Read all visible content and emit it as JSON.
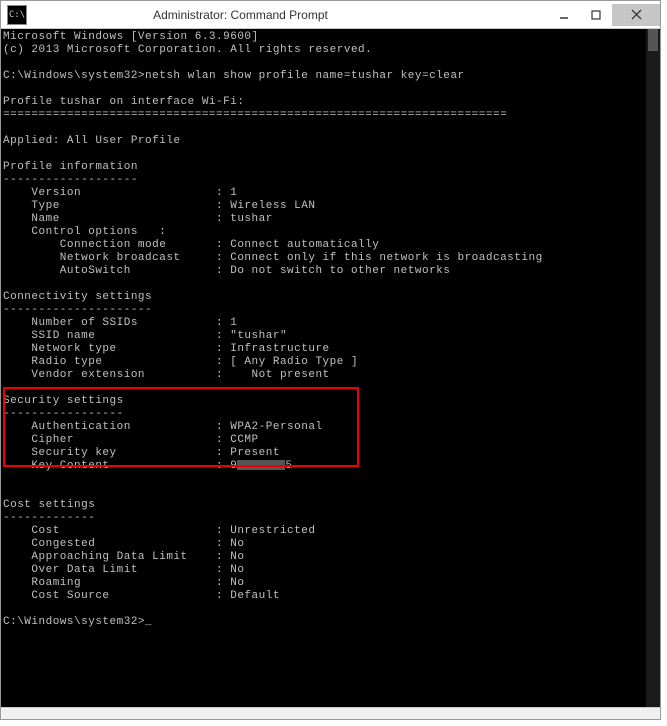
{
  "titlebar": {
    "icon_label": "C:\\",
    "title": "Administrator: Command Prompt"
  },
  "header": {
    "version_line": "Microsoft Windows [Version 6.3.9600]",
    "copyright_line": "(c) 2013 Microsoft Corporation. All rights reserved."
  },
  "prompt1": {
    "path": "C:\\Windows\\system32>",
    "command": "netsh wlan show profile name=tushar key=clear"
  },
  "profile_header": "Profile tushar on interface Wi-Fi:",
  "separator": "=======================================================================",
  "applied": {
    "label": "Applied:",
    "value": "All User Profile"
  },
  "sections": {
    "profile_info": {
      "title": "Profile information",
      "underline": "-------------------",
      "rows": [
        {
          "k": "Version",
          "v": "1"
        },
        {
          "k": "Type",
          "v": "Wireless LAN"
        },
        {
          "k": "Name",
          "v": "tushar"
        },
        {
          "k": "Control options",
          "v": ""
        }
      ],
      "sub_rows": [
        {
          "k": "Connection mode",
          "v": "Connect automatically"
        },
        {
          "k": "Network broadcast",
          "v": "Connect only if this network is broadcasting"
        },
        {
          "k": "AutoSwitch",
          "v": "Do not switch to other networks"
        }
      ]
    },
    "connectivity": {
      "title": "Connectivity settings",
      "underline": "---------------------",
      "rows": [
        {
          "k": "Number of SSIDs",
          "v": "1"
        },
        {
          "k": "SSID name",
          "v": "\"tushar\""
        },
        {
          "k": "Network type",
          "v": "Infrastructure"
        },
        {
          "k": "Radio type",
          "v": "[ Any Radio Type ]"
        },
        {
          "k": "Vendor extension",
          "v": "Not present",
          "indent_v": true
        }
      ]
    },
    "security": {
      "title": "Security settings",
      "underline": "-----------------",
      "rows": [
        {
          "k": "Authentication",
          "v": "WPA2-Personal"
        },
        {
          "k": "Cipher",
          "v": "CCMP"
        },
        {
          "k": "Security key",
          "v": "Present"
        },
        {
          "k": "Key Content",
          "v_prefix": "9",
          "v_suffix": "5",
          "obscured": true
        }
      ]
    },
    "cost": {
      "title": "Cost settings",
      "underline": "-------------",
      "rows": [
        {
          "k": "Cost",
          "v": "Unrestricted"
        },
        {
          "k": "Congested",
          "v": "No"
        },
        {
          "k": "Approaching Data Limit",
          "v": "No"
        },
        {
          "k": "Over Data Limit",
          "v": "No"
        },
        {
          "k": "Roaming",
          "v": "No"
        },
        {
          "k": "Cost Source",
          "v": "Default"
        }
      ]
    }
  },
  "prompt2": {
    "path": "C:\\Windows\\system32>",
    "cursor": "_"
  }
}
